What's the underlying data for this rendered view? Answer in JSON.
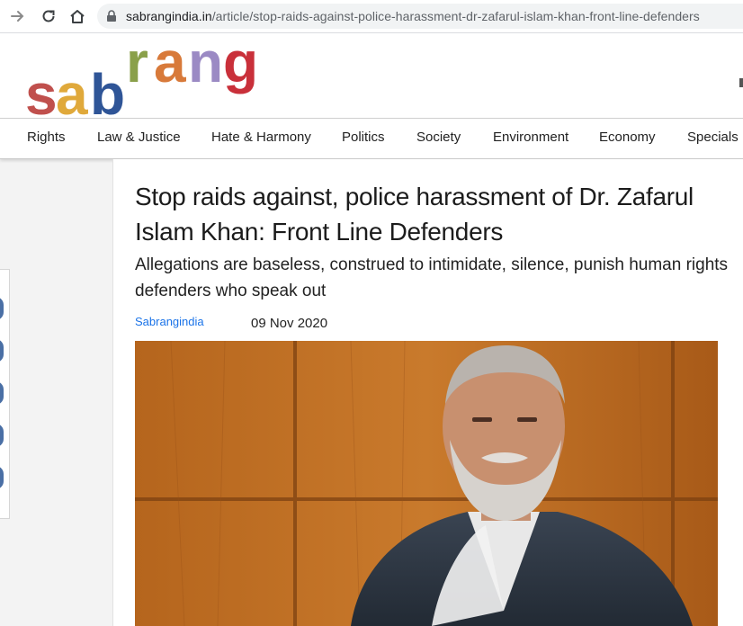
{
  "browser": {
    "url_host": "sabrangindia.in",
    "url_path": "/article/stop-raids-against-police-harassment-dr-zafarul-islam-khan-front-line-defenders",
    "icons": [
      "forward-icon",
      "reload-icon",
      "home-icon",
      "lock-icon"
    ]
  },
  "site": {
    "logo_text": "sabrang",
    "logo_colors": [
      "#c0504d",
      "#e0a93b",
      "#2f5597",
      "#8aa04a",
      "#d87a3a",
      "#9b8ac4",
      "#c9303a"
    ]
  },
  "nav": {
    "items": [
      {
        "label": "Rights"
      },
      {
        "label": "Law & Justice"
      },
      {
        "label": "Hate & Harmony"
      },
      {
        "label": "Politics"
      },
      {
        "label": "Society"
      },
      {
        "label": "Environment"
      },
      {
        "label": "Economy"
      },
      {
        "label": "Specials"
      }
    ]
  },
  "article": {
    "title": "Stop raids against, police harassment of Dr. Zafarul Islam Khan: Front Line Defenders",
    "subtitle": "Allegations are baseless, construed to intimidate, silence, punish human rights defenders who speak out",
    "author": "Sabrangindia",
    "date": "09 Nov 2020"
  }
}
